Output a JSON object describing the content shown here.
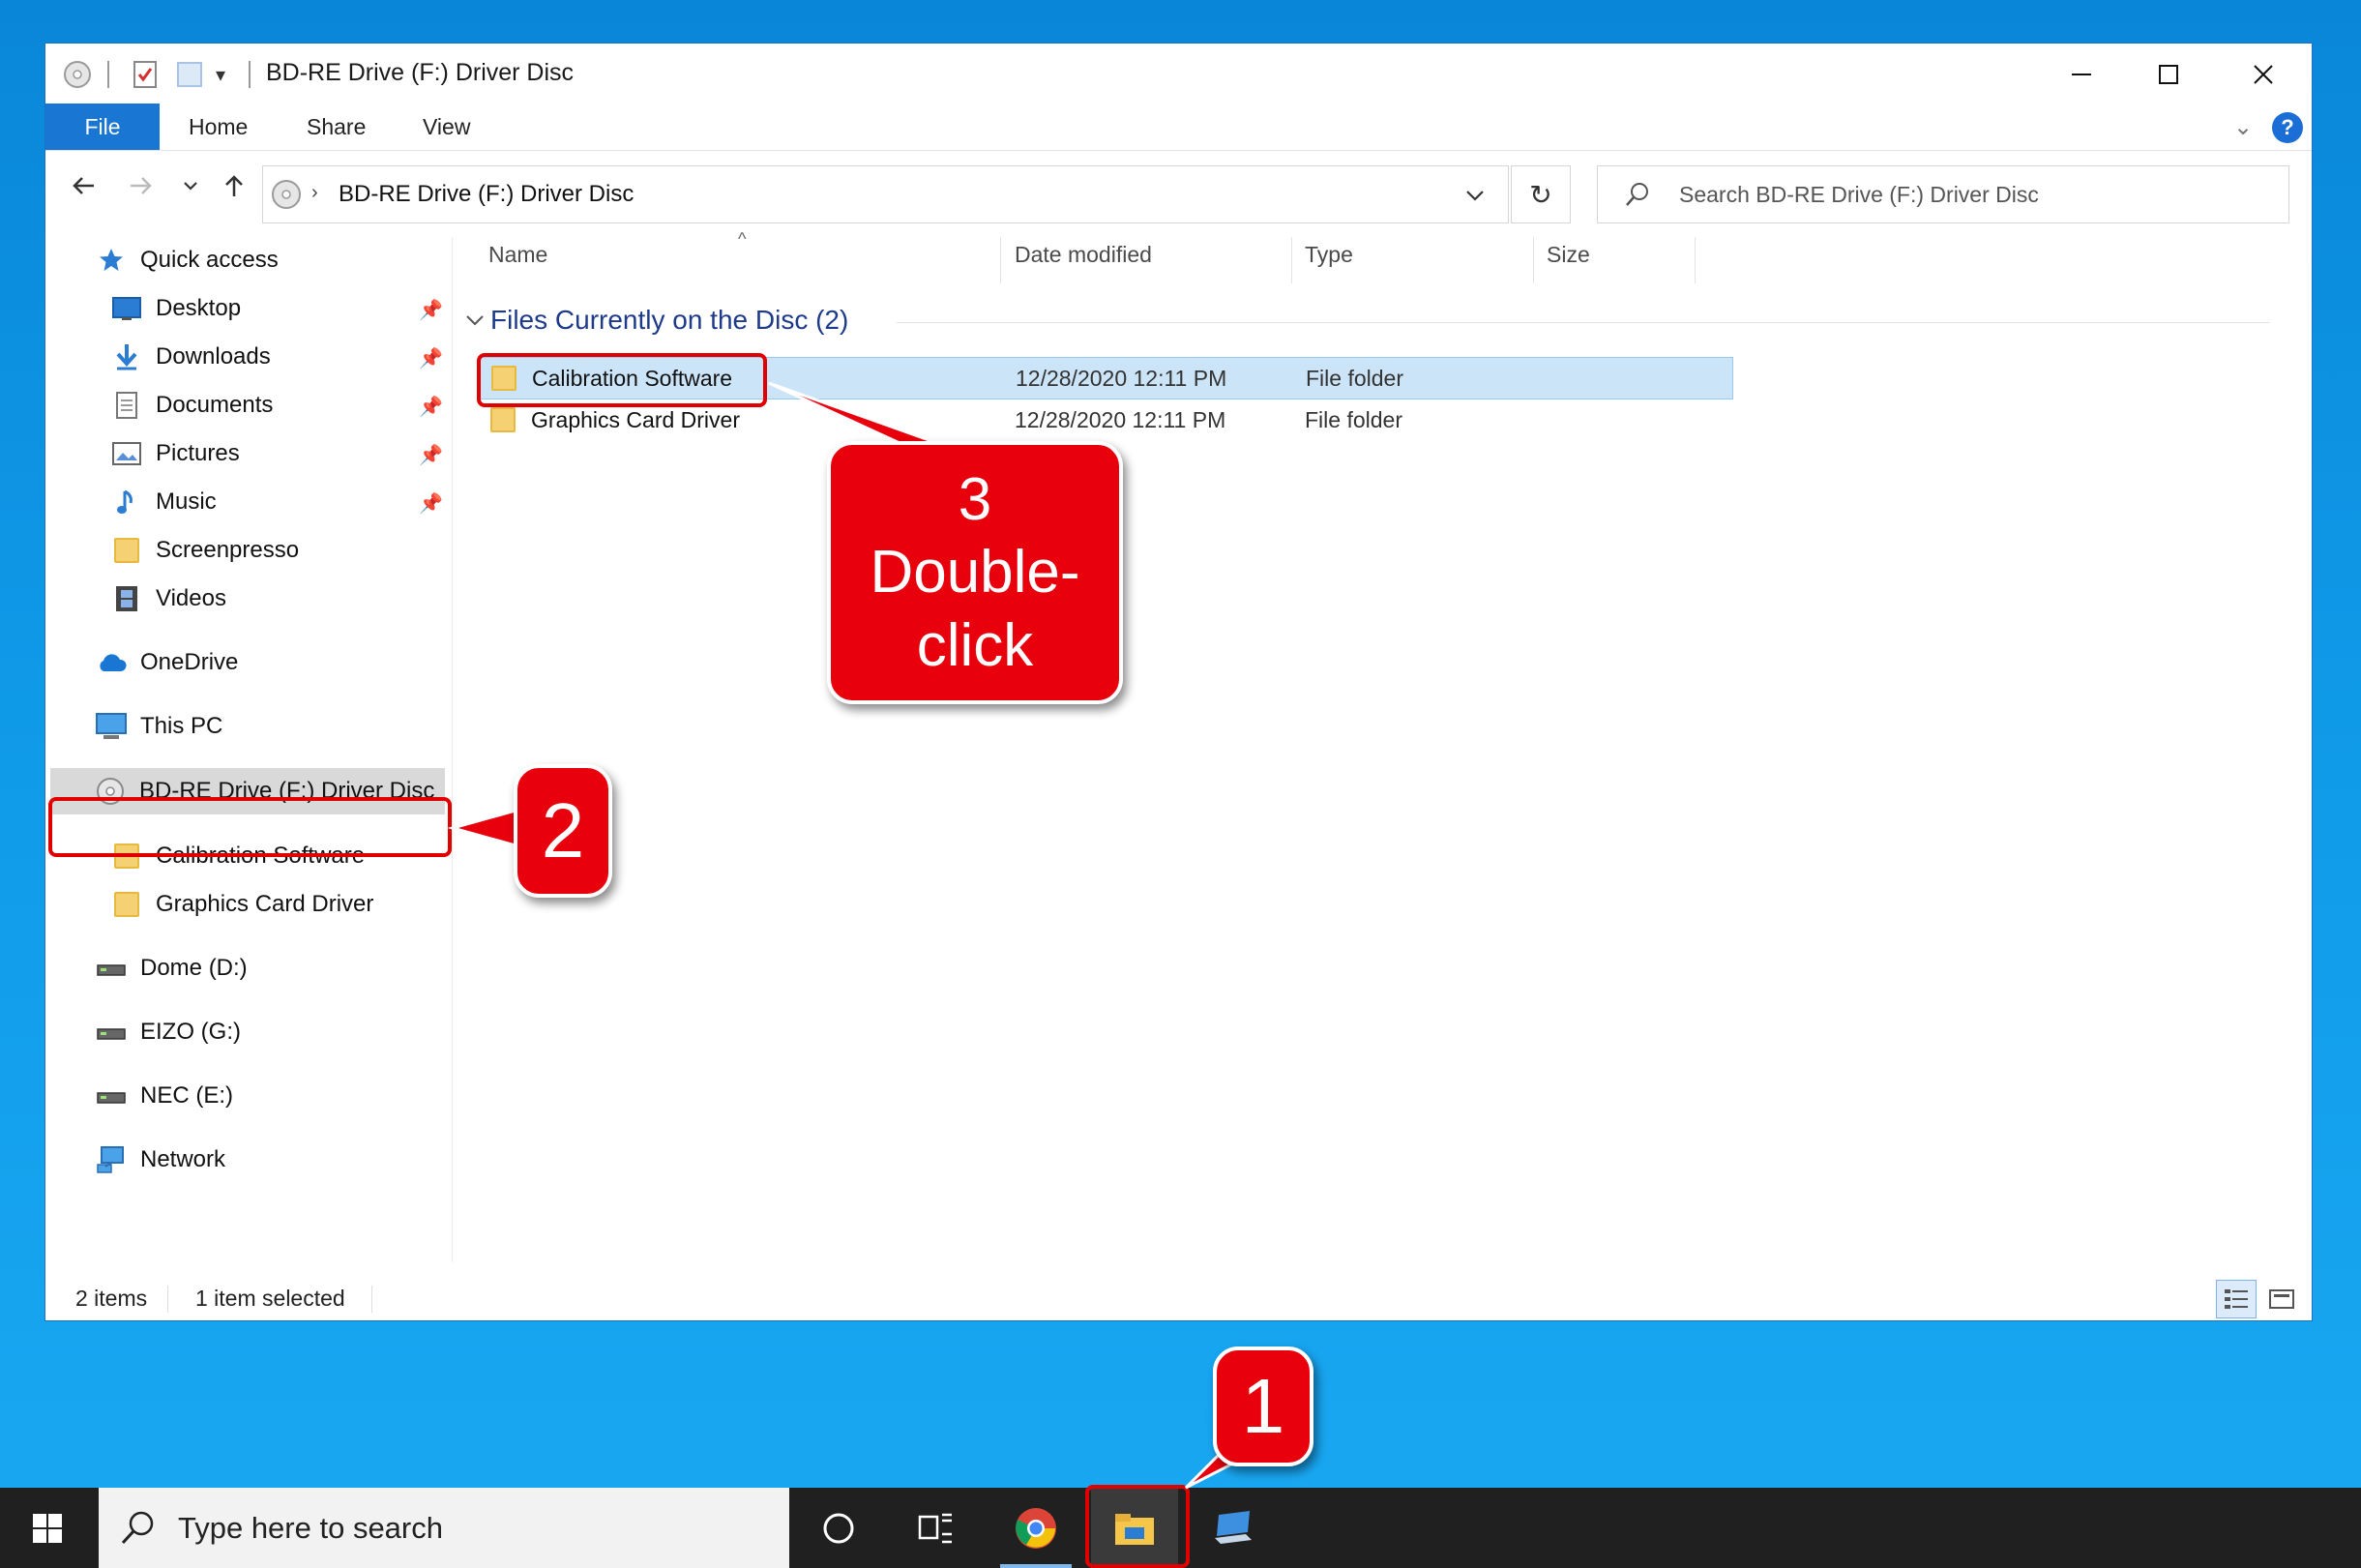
{
  "window": {
    "title": "BD-RE Drive (F:) Driver Disc"
  },
  "ribbon": {
    "tabs": [
      "File",
      "Home",
      "Share",
      "View"
    ]
  },
  "address": {
    "path": "BD-RE Drive (F:) Driver Disc",
    "search_placeholder": "Search BD-RE Drive (F:) Driver Disc"
  },
  "navpane": {
    "quick_access": "Quick access",
    "quick_items": [
      "Desktop",
      "Downloads",
      "Documents",
      "Pictures",
      "Music",
      "Screenpresso",
      "Videos"
    ],
    "onedrive": "OneDrive",
    "this_pc": "This PC",
    "drive": "BD-RE Drive (F:) Driver Disc",
    "drive_children": [
      "Calibration Software",
      "Graphics Card Driver"
    ],
    "other_drives": [
      "Dome (D:)",
      "EIZO (G:)",
      "NEC (E:)"
    ],
    "network": "Network"
  },
  "columns": {
    "name": "Name",
    "date": "Date modified",
    "type": "Type",
    "size": "Size"
  },
  "group": {
    "header": "Files Currently on the Disc (2)"
  },
  "files": [
    {
      "name": "Calibration Software",
      "date": "12/28/2020 12:11 PM",
      "type": "File folder",
      "selected": true
    },
    {
      "name": "Graphics Card Driver",
      "date": "12/28/2020 12:11 PM",
      "type": "File folder",
      "selected": false
    }
  ],
  "status": {
    "count": "2 items",
    "selection": "1 item selected"
  },
  "taskbar": {
    "search_placeholder": "Type here to search"
  },
  "annotations": {
    "step1": "1",
    "step2": "2",
    "step3_line1": "3",
    "step3_line2": "Double-",
    "step3_line3": "click"
  },
  "colors": {
    "accent": "#1976d2",
    "selection": "#cce4f7",
    "annotation": "#e8000d"
  }
}
